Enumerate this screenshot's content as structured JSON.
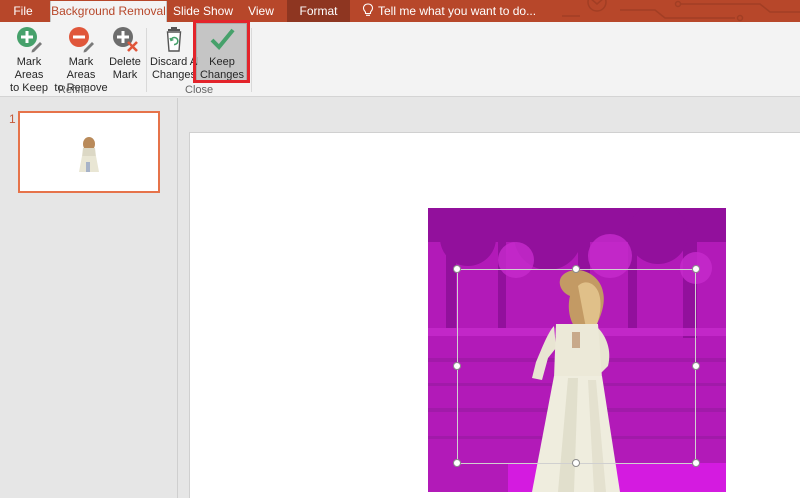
{
  "tabs": [
    {
      "label": "File"
    },
    {
      "label": "Background Removal"
    },
    {
      "label": "Slide Show"
    },
    {
      "label": "View"
    },
    {
      "label": "Format"
    }
  ],
  "tellme": {
    "text": "Tell me what you want to do..."
  },
  "ribbon": {
    "mark_keep": {
      "line1": "Mark Areas",
      "line2": "to Keep"
    },
    "mark_remove": {
      "line1": "Mark Areas",
      "line2": "to Remove"
    },
    "delete_mark": {
      "line1": "Delete",
      "line2": "Mark"
    },
    "discard": {
      "line1": "Discard All",
      "line2": "Changes"
    },
    "keep": {
      "line1": "Keep",
      "line2": "Changes"
    },
    "groups": {
      "refine": "Refine",
      "close": "Close"
    }
  },
  "slides": {
    "number": "1"
  },
  "colors": {
    "accent": "#b7472a",
    "removal_overlay": "#c000c0",
    "highlight_box": "#e3242b"
  }
}
